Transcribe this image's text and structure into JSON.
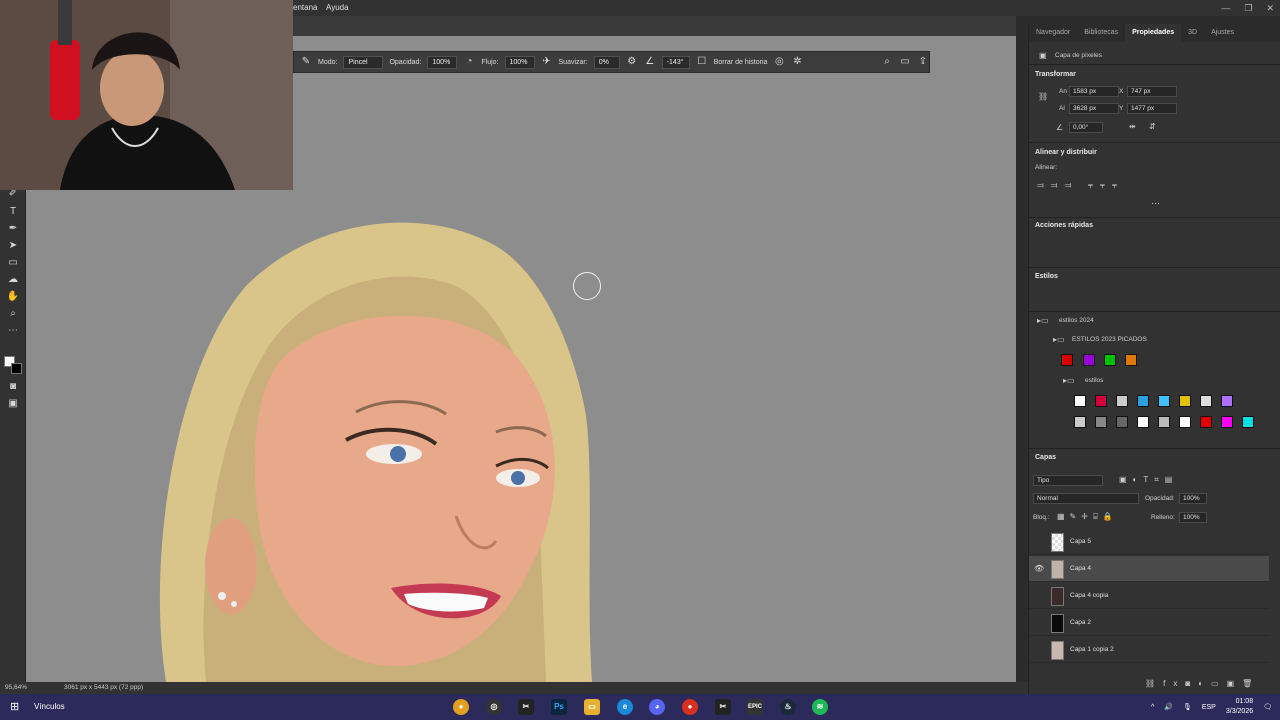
{
  "menu": {
    "items": [
      "entana",
      "Ayuda"
    ]
  },
  "window_controls": [
    "—",
    "❐",
    "✕"
  ],
  "options_bar": {
    "mode_label": "Modo:",
    "mode_value": "Pincel",
    "opacity_label": "Opacidad:",
    "opacity_value": "100%",
    "flow_label": "Flujo:",
    "flow_value": "100%",
    "smooth_label": "Suavizar:",
    "smooth_value": "0%",
    "angle_value": "-143°",
    "history_label": "Borrar de historia"
  },
  "right_panel": {
    "tabs": [
      "Navegador",
      "Bibliotecas",
      "Propiedades",
      "3D",
      "Ajustes"
    ],
    "layer_type": "Capa de píxeles",
    "transform": {
      "title": "Transformar",
      "w_label": "An",
      "w_value": "1583 px",
      "x_label": "X",
      "x_value": "747 px",
      "h_label": "Al",
      "h_value": "3628 px",
      "y_label": "Y",
      "y_value": "1477 px",
      "angle_value": "0,00°"
    },
    "align": {
      "title": "Alinear y distribuir",
      "align_label": "Alinear:"
    },
    "quick_actions": "Acciones rápidas",
    "styles": {
      "title": "Estilos",
      "group1": "estilos 2024",
      "group2": "ESTILOS 2023 PICADOS",
      "group3": "estilos",
      "colors": [
        "#d40000",
        "#9b00d4",
        "#00c000",
        "#e07800"
      ],
      "row2": [
        "#ffffff",
        "#d4003c",
        "#cccccc",
        "#2aa0e0",
        "#40c0ff",
        "#e0c000",
        "#dddddd",
        "#b070ff"
      ],
      "row3": [
        "#cccccc",
        "#888888",
        "#666666",
        "#ffffff",
        "#bbbbbb",
        "#ffffff",
        "#e00000",
        "#ff00ff",
        "#00e0e0"
      ]
    },
    "layers": {
      "title": "Capas",
      "filter": "Tipo",
      "blend": "Normal",
      "opacity_label": "Opacidad:",
      "opacity_value": "100%",
      "lock_label": "Bloq.:",
      "fill_label": "Relleno:",
      "fill_value": "100%",
      "rows": [
        {
          "name": "Capa 5",
          "visible": false,
          "selected": false
        },
        {
          "name": "Capa 4",
          "visible": true,
          "selected": true
        },
        {
          "name": "Capa 4 copia",
          "visible": false,
          "selected": false
        },
        {
          "name": "Capa 2",
          "visible": false,
          "selected": false
        },
        {
          "name": "Capa 1 copia 2",
          "visible": false,
          "selected": false
        }
      ]
    }
  },
  "status": {
    "zoom": "95,64%",
    "doc_info": "3061 px x 5443 px (72 ppp)"
  },
  "taskbar": {
    "start_label": "Vínculos",
    "apps": [
      "chrome",
      "obs",
      "capcut",
      "Ps",
      "files",
      "edge",
      "discord",
      "chrome2",
      "capcut2",
      "epic",
      "steam",
      "spotify"
    ],
    "lang": "ESP",
    "time": "01:08",
    "date": "3/3/2026"
  }
}
